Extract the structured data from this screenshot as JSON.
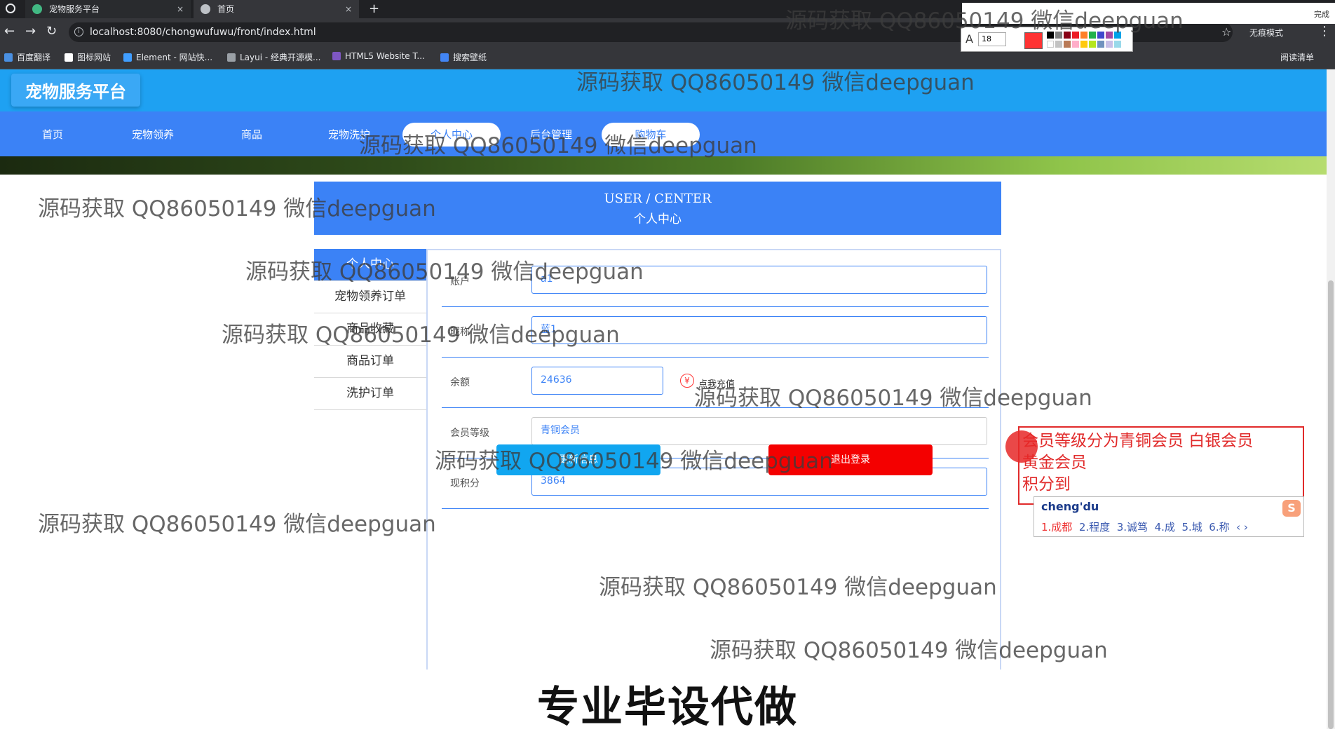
{
  "browser": {
    "tabs": [
      {
        "title": "宠物服务平台",
        "icon_color": "#41b883"
      },
      {
        "title": "首页",
        "icon_color": "#bdc1c6"
      }
    ],
    "close_glyph": "×",
    "new_tab": "+",
    "url": "localhost:8080/chongwufuwu/front/index.html",
    "bookmarks": [
      "百度翻译",
      "图标网站",
      "Element - 网站快...",
      "Layui - 经典开源模...",
      "HTML5 Website T...",
      "搜索壁纸"
    ],
    "incognito_label": "无痕模式",
    "reading_list": "阅读清单",
    "ext_done": "完成",
    "font_size": "18"
  },
  "site": {
    "logo": "宠物服务平台",
    "nav": [
      "首页",
      "宠物领养",
      "商品",
      "宠物洗护",
      "个人中心",
      "后台管理",
      "购物车"
    ],
    "primary_color": "#3b82f6"
  },
  "user_center": {
    "title_en": "USER / CENTER",
    "title_cn": "个人中心",
    "sidebar": [
      "个人中心",
      "宠物领养订单",
      "商品收藏",
      "商品订单",
      "洗护订单"
    ],
    "fields": {
      "account": {
        "label": "账户",
        "value": "a1"
      },
      "nickname": {
        "label": "昵称",
        "value": "蓝1"
      },
      "balance": {
        "label": "余额",
        "value": "24636"
      },
      "level": {
        "label": "会员等级",
        "value": "青铜会员"
      },
      "points": {
        "label": "现积分",
        "value": "3864"
      }
    },
    "recharge_label": "点我充值",
    "recharge_icon": "¥",
    "update_button": "更新信息",
    "logout_button": "退出登录"
  },
  "annotation": {
    "text": "会员等级分为青铜会员 白银会员\n黄金会员\n积分到"
  },
  "ime": {
    "input": "cheng'du",
    "candidates": [
      "1.成都",
      "2.程度",
      "3.诚笃",
      "4.成",
      "5.城",
      "6.称"
    ],
    "logo": "S"
  },
  "watermark": "源码获取 QQ86050149 微信deepguan",
  "caption": "专业毕设代做"
}
